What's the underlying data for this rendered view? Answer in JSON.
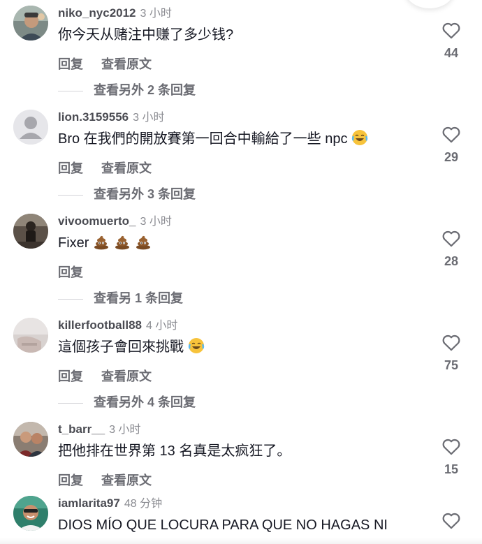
{
  "comments": [
    {
      "username": "niko_nyc2012",
      "time": "3 小时",
      "text": "你今天从赌注中赚了多少钱?",
      "reply_label": "回复",
      "view_original_label": "查看原文",
      "view_replies_label": "查看另外 2 条回复",
      "likes": "44",
      "emoji": [],
      "avatar_icon": "person-photo-avatar"
    },
    {
      "username": "lion.3159556",
      "time": "3 小时",
      "text": "Bro 在我們的開放賽第一回合中輸給了一些 npc",
      "reply_label": "回复",
      "view_original_label": "查看原文",
      "view_replies_label": "查看另外 3 条回复",
      "likes": "29",
      "emoji": [
        "tears-of-joy-emoji"
      ],
      "avatar_icon": "default-user-avatar"
    },
    {
      "username": "vivoomuerto_",
      "time": "3 小时",
      "text": "Fixer",
      "reply_label": "回复",
      "view_original_label": "",
      "view_replies_label": "查看另 1 条回复",
      "likes": "28",
      "emoji": [
        "poop-emoji",
        "poop-emoji",
        "poop-emoji"
      ],
      "avatar_icon": "person-photo-avatar"
    },
    {
      "username": "killerfootball88",
      "time": "4 小时",
      "text": "這個孩子會回來挑戰",
      "reply_label": "回复",
      "view_original_label": "查看原文",
      "view_replies_label": "查看另外 4 条回复",
      "likes": "75",
      "emoji": [
        "tears-of-joy-emoji"
      ],
      "avatar_icon": "photo-avatar"
    },
    {
      "username": "t_barr__",
      "time": "3 小时",
      "text": "把他排在世界第 13 名真是太疯狂了。",
      "reply_label": "回复",
      "view_original_label": "查看原文",
      "view_replies_label": "",
      "likes": "15",
      "emoji": [],
      "avatar_icon": "person-photo-avatar"
    },
    {
      "username": "iamlarita97",
      "time": "48 分钟",
      "text": "DIOS MÍO QUE LOCURA PARA QUE NO HAGAS NI",
      "reply_label": "",
      "view_original_label": "",
      "view_replies_label": "",
      "likes": "",
      "emoji": [],
      "avatar_icon": "person-photo-avatar"
    }
  ],
  "icons": {
    "like": "heart-outline-icon"
  },
  "colors": {
    "username": "#4a4b52",
    "secondary_text": "#6b6c73",
    "timestamp": "#8a8b91",
    "body_text": "#161823"
  }
}
